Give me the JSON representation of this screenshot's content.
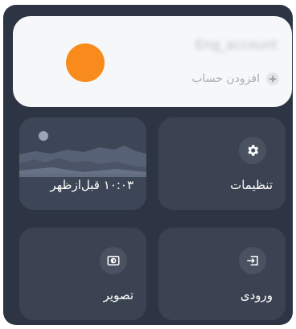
{
  "account": {
    "name": "Eng_account",
    "add_label": "افزودن حساب",
    "avatar_color": "#f98a1c"
  },
  "tiles": {
    "clock": {
      "time_label": "۱۰:۰۳ قبل‌ازظهر"
    },
    "settings": {
      "label": "تنظیمات",
      "icon": "gear-icon"
    },
    "picture": {
      "label": "تصویر",
      "icon": "picture-mode-icon"
    },
    "input": {
      "label": "ورودی",
      "icon": "input-source-icon"
    }
  },
  "colors": {
    "panel_bg": "#2d3544",
    "tile_bg": "#3b4352",
    "card_bg": "#f6f7f9"
  }
}
